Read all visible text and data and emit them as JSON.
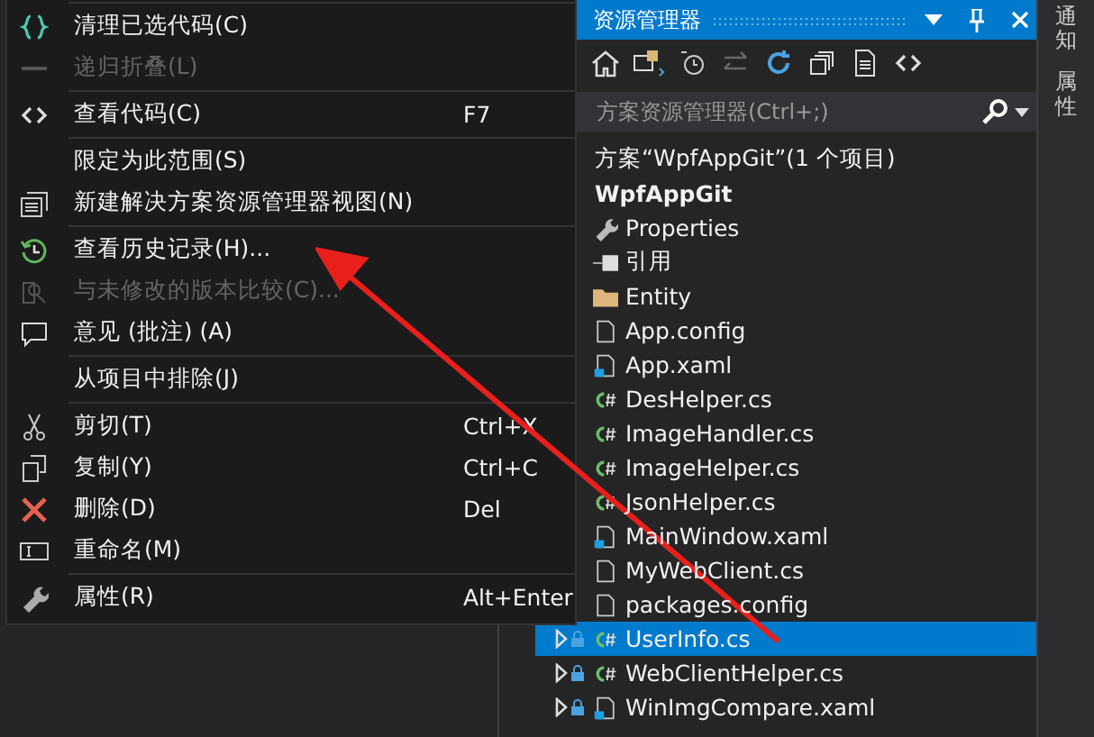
{
  "context_menu": {
    "items": [
      {
        "kind": "separator"
      },
      {
        "kind": "item",
        "label": "清理已选代码(C)",
        "disabled": false
      },
      {
        "kind": "item",
        "label": "递归折叠(L)",
        "disabled": true
      },
      {
        "kind": "separator"
      },
      {
        "kind": "item",
        "label": "查看代码(C)",
        "shortcut": "F7",
        "disabled": false
      },
      {
        "kind": "separator"
      },
      {
        "kind": "item",
        "label": "限定为此范围(S)",
        "disabled": false
      },
      {
        "kind": "item",
        "label": "新建解决方案资源管理器视图(N)",
        "disabled": false
      },
      {
        "kind": "separator"
      },
      {
        "kind": "item",
        "label": "查看历史记录(H)...",
        "disabled": false
      },
      {
        "kind": "item",
        "label": "与未修改的版本比较(C)...",
        "disabled": true
      },
      {
        "kind": "item",
        "label": "意见 (批注) (A)",
        "disabled": false
      },
      {
        "kind": "separator"
      },
      {
        "kind": "item",
        "label": "从项目中排除(J)",
        "disabled": false
      },
      {
        "kind": "separator"
      },
      {
        "kind": "item",
        "label": "剪切(T)",
        "shortcut": "Ctrl+X",
        "disabled": false
      },
      {
        "kind": "item",
        "label": "复制(Y)",
        "shortcut": "Ctrl+C",
        "disabled": false
      },
      {
        "kind": "item",
        "label": "删除(D)",
        "shortcut": "Del",
        "disabled": false
      },
      {
        "kind": "item",
        "label": "重命名(M)",
        "disabled": false
      },
      {
        "kind": "separator"
      },
      {
        "kind": "item",
        "label": "属性(R)",
        "shortcut": "Alt+Enter",
        "disabled": false
      }
    ]
  },
  "solution_explorer": {
    "title": "资源管理器",
    "search": {
      "placeholder": "方案资源管理器(Ctrl+;)"
    },
    "tree": [
      {
        "kind": "solution",
        "label": "方案“WpfAppGit”(1 个项目)",
        "selected": false
      },
      {
        "kind": "project",
        "label": "WpfAppGit",
        "selected": false
      },
      {
        "kind": "properties",
        "label": "Properties",
        "selected": false
      },
      {
        "kind": "references",
        "label": "引用",
        "selected": false
      },
      {
        "kind": "folder",
        "label": "Entity",
        "selected": false
      },
      {
        "kind": "config",
        "label": "App.config",
        "selected": false
      },
      {
        "kind": "xaml",
        "label": "App.xaml",
        "selected": false
      },
      {
        "kind": "cs",
        "label": "DesHelper.cs",
        "selected": false
      },
      {
        "kind": "cs",
        "label": "ImageHandler.cs",
        "selected": false
      },
      {
        "kind": "cs",
        "label": "ImageHelper.cs",
        "selected": false
      },
      {
        "kind": "cs",
        "label": "JsonHelper.cs",
        "selected": false
      },
      {
        "kind": "xaml",
        "label": "MainWindow.xaml",
        "selected": false
      },
      {
        "kind": "config",
        "label": "MyWebClient.cs",
        "selected": false
      },
      {
        "kind": "config",
        "label": "packages.config",
        "selected": false
      },
      {
        "kind": "cs",
        "label": "UserInfo.cs",
        "selected": true,
        "expanded": false,
        "locked": true
      },
      {
        "kind": "cs",
        "label": "WebClientHelper.cs",
        "selected": false,
        "expanded": false,
        "locked": true
      },
      {
        "kind": "xaml",
        "label": "WinImgCompare.xaml",
        "selected": false,
        "expanded": false,
        "locked": true
      }
    ]
  },
  "side_tabs": [
    {
      "label": "通知"
    },
    {
      "label": "属性"
    }
  ]
}
